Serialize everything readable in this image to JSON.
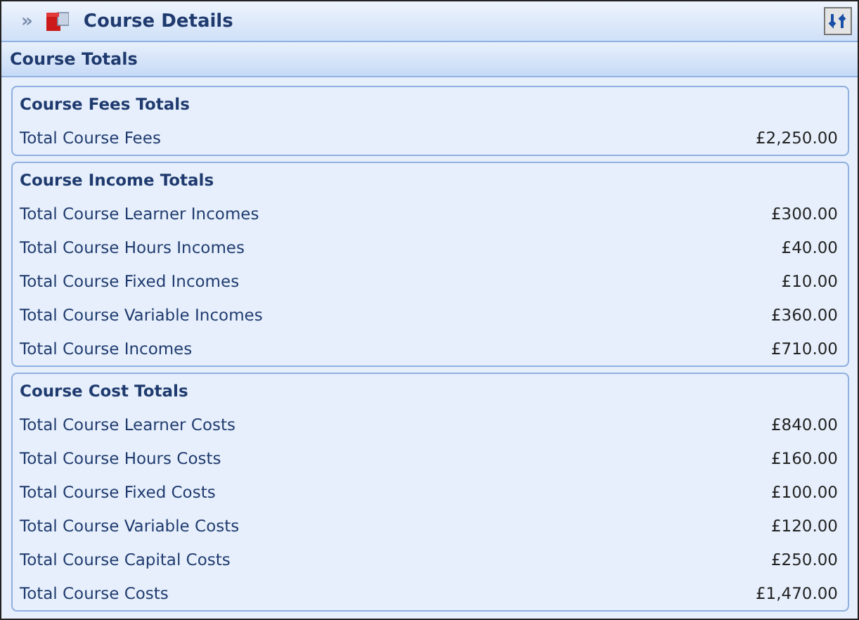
{
  "header": {
    "expand_glyph": "»",
    "title": "Course Details"
  },
  "section": {
    "title": "Course Totals"
  },
  "groups": [
    {
      "title": "Course Fees Totals",
      "rows": [
        {
          "label": "Total Course Fees",
          "value": "£2,250.00"
        }
      ]
    },
    {
      "title": "Course Income Totals",
      "rows": [
        {
          "label": "Total Course Learner Incomes",
          "value": "£300.00"
        },
        {
          "label": "Total Course Hours Incomes",
          "value": "£40.00"
        },
        {
          "label": "Total Course Fixed Incomes",
          "value": "£10.00"
        },
        {
          "label": "Total Course Variable Incomes",
          "value": "£360.00"
        },
        {
          "label": "Total Course Incomes",
          "value": "£710.00"
        }
      ]
    },
    {
      "title": "Course Cost Totals",
      "rows": [
        {
          "label": "Total Course Learner Costs",
          "value": "£840.00"
        },
        {
          "label": "Total Course Hours Costs",
          "value": "£160.00"
        },
        {
          "label": "Total Course Fixed Costs",
          "value": "£100.00"
        },
        {
          "label": "Total Course Variable Costs",
          "value": "£120.00"
        },
        {
          "label": "Total Course Capital Costs",
          "value": "£250.00"
        },
        {
          "label": "Total Course Costs",
          "value": "£1,470.00"
        }
      ]
    }
  ]
}
